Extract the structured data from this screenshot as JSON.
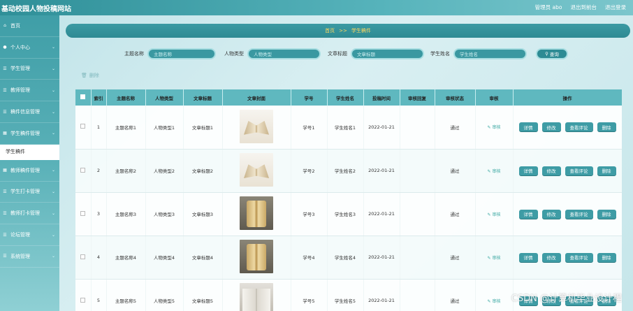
{
  "header": {
    "site_title": "基动校园人物投稿网站",
    "admin_label": "管理员 abo",
    "back_link": "退出到前台",
    "logout_link": "退出登录"
  },
  "sidebar": {
    "items": [
      {
        "label": "首页",
        "icon": "home-icon"
      },
      {
        "label": "个人中心",
        "icon": "user-icon"
      },
      {
        "label": "学生管理",
        "icon": "list-icon"
      },
      {
        "label": "教师管理",
        "icon": "list-icon"
      },
      {
        "label": "稿件信息管理",
        "icon": "list-icon"
      },
      {
        "label": "学生稿件管理",
        "icon": "grid-icon"
      },
      {
        "label": "学生稿件",
        "icon": "",
        "sub": true
      },
      {
        "label": "教师稿件管理",
        "icon": "grid-icon"
      },
      {
        "label": "学生打卡管理",
        "icon": "list-icon"
      },
      {
        "label": "教师打卡管理",
        "icon": "list-icon"
      },
      {
        "label": "论坛管理",
        "icon": "list-icon"
      },
      {
        "label": "系统管理",
        "icon": "list-icon"
      }
    ]
  },
  "breadcrumb": {
    "home": "首页",
    "separator": ">>",
    "current": "学生稿件"
  },
  "search": {
    "fields": [
      {
        "label": "主题名称",
        "placeholder": "主题名称"
      },
      {
        "label": "人物类型",
        "placeholder": "人物类型"
      },
      {
        "label": "文章标题",
        "placeholder": "文章标题"
      },
      {
        "label": "学生姓名",
        "placeholder": "学生姓名"
      }
    ],
    "button_label": "查询"
  },
  "toolbar": {
    "delete_label": "删除"
  },
  "table": {
    "columns": [
      "索引",
      "主题名称",
      "人物类型",
      "文章标题",
      "文章封面",
      "学号",
      "学生姓名",
      "投稿时间",
      "审核回复",
      "审核状态",
      "审核",
      "操作"
    ],
    "rows": [
      {
        "index": "1",
        "theme": "主题名称1",
        "type": "人物类型1",
        "title": "文章标题1",
        "cover": "b1",
        "student_no": "学号1",
        "name": "学生姓名1",
        "time": "2022-01-21",
        "reply": "",
        "status": "通过",
        "audit": "审核"
      },
      {
        "index": "2",
        "theme": "主题名称2",
        "type": "人物类型2",
        "title": "文章标题2",
        "cover": "b1",
        "student_no": "学号2",
        "name": "学生姓名2",
        "time": "2022-01-21",
        "reply": "",
        "status": "通过",
        "audit": "审核"
      },
      {
        "index": "3",
        "theme": "主题名称3",
        "type": "人物类型3",
        "title": "文章标题3",
        "cover": "b2",
        "student_no": "学号3",
        "name": "学生姓名3",
        "time": "2022-01-21",
        "reply": "",
        "status": "通过",
        "audit": "审核"
      },
      {
        "index": "4",
        "theme": "主题名称4",
        "type": "人物类型4",
        "title": "文章标题4",
        "cover": "b2",
        "student_no": "学号4",
        "name": "学生姓名4",
        "time": "2022-01-21",
        "reply": "",
        "status": "通过",
        "audit": "审核"
      },
      {
        "index": "5",
        "theme": "主题名称5",
        "type": "人物类型5",
        "title": "文章标题5",
        "cover": "b3",
        "student_no": "学号5",
        "name": "学生姓名5",
        "time": "2022-01-21",
        "reply": "",
        "status": "通过",
        "audit": "审核"
      }
    ],
    "actions": {
      "detail": "详情",
      "edit": "修改",
      "comments": "查看评论",
      "delete": "删除"
    }
  },
  "watermark": "CSDN @计算机毕业设计程",
  "colors": {
    "accent": "#3e9ca5",
    "header": "#5fb8bf",
    "breadcrumb_text": "#ffd75e"
  }
}
